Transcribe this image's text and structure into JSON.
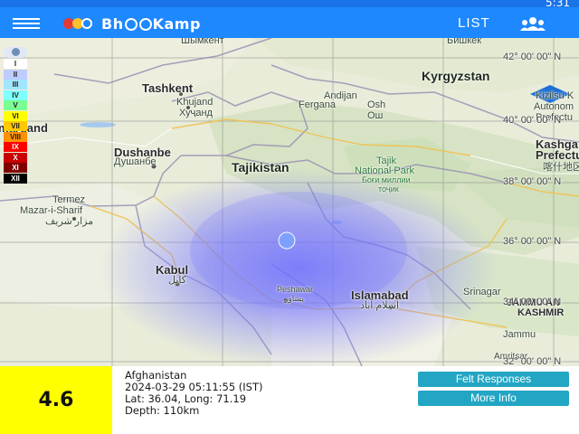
{
  "status_bar": {
    "time": "5:31"
  },
  "app_bar": {
    "title_prefix": "Bh",
    "title_suffix": "Kamp",
    "list_label": "LIST",
    "colors": {
      "bar": "#1e88ff",
      "logo_dot_left": "#e53935",
      "logo_dot_mid": "#fbc02d",
      "logo_dot_right": "#1e88ff"
    }
  },
  "legend": {
    "levels": [
      {
        "label": "I",
        "color": "#ffffff"
      },
      {
        "label": "II",
        "color": "#bfccff"
      },
      {
        "label": "III",
        "color": "#a0e6ff"
      },
      {
        "label": "IV",
        "color": "#80ffff"
      },
      {
        "label": "V",
        "color": "#7aff93"
      },
      {
        "label": "VI",
        "color": "#ffff00"
      },
      {
        "label": "VII",
        "color": "#ffc800"
      },
      {
        "label": "VIII",
        "color": "#ff9100"
      },
      {
        "label": "IX",
        "color": "#ff0000"
      },
      {
        "label": "X",
        "color": "#c80000"
      },
      {
        "label": "XI",
        "color": "#800000"
      },
      {
        "label": "XII",
        "color": "#000000"
      }
    ]
  },
  "map": {
    "places": [
      {
        "id": "shymkent",
        "text": "Шымкент"
      },
      {
        "id": "bishkek",
        "text": "Бишкек"
      },
      {
        "id": "kyrgyzstan",
        "text": "Kyrgyzstan"
      },
      {
        "id": "tashkent",
        "text": "Tashkent"
      },
      {
        "id": "khujand",
        "text": "Khujand"
      },
      {
        "id": "khujand_local",
        "text": "Хуҷанд"
      },
      {
        "id": "andijan",
        "text": "Andijan"
      },
      {
        "id": "fergana",
        "text": "Fergana"
      },
      {
        "id": "osh",
        "text": "Osh"
      },
      {
        "id": "osh_local",
        "text": "Ош"
      },
      {
        "id": "kizilsu",
        "text": "Kizilsu K"
      },
      {
        "id": "autonomous",
        "text": "Autonom"
      },
      {
        "id": "prefecture",
        "text": "Prefectu"
      },
      {
        "id": "samarkand",
        "text": "marqand"
      },
      {
        "id": "dushanbe",
        "text": "Dushanbe"
      },
      {
        "id": "dushanbe_local",
        "text": "Душанбе"
      },
      {
        "id": "tajikistan",
        "text": "Tajikistan"
      },
      {
        "id": "tajik_park",
        "text": "Tajik"
      },
      {
        "id": "tajik_park2",
        "text": "National Park"
      },
      {
        "id": "tajik_park3",
        "text": "Боғи миллии"
      },
      {
        "id": "tajik_park4",
        "text": "тоҷик"
      },
      {
        "id": "kashgar",
        "text": "Kashga"
      },
      {
        "id": "prefecture2",
        "text": "Prefectu"
      },
      {
        "id": "kashgar_local",
        "text": "喀什地区"
      },
      {
        "id": "termez",
        "text": "Termez"
      },
      {
        "id": "mazar",
        "text": "Mazar-i-Sharif"
      },
      {
        "id": "mazar_local",
        "text": "مزار شریف"
      },
      {
        "id": "kabul",
        "text": "Kabul"
      },
      {
        "id": "kabul_local",
        "text": "کابل"
      },
      {
        "id": "peshawar",
        "text": "Peshawar"
      },
      {
        "id": "peshawar_local",
        "text": "پشاور"
      },
      {
        "id": "islamabad",
        "text": "Islamabad"
      },
      {
        "id": "islamabad_local",
        "text": "اسلام آباد"
      },
      {
        "id": "srinagar",
        "text": "Srinagar"
      },
      {
        "id": "jk",
        "text": "JAMMU AN"
      },
      {
        "id": "kashmir",
        "text": "KASHMIR"
      },
      {
        "id": "jammu",
        "text": "Jammu"
      },
      {
        "id": "amritsar",
        "text": "Amritsar"
      }
    ],
    "grid_labels": [
      {
        "id": "lat42",
        "text": "42° 00' 00\" N"
      },
      {
        "id": "lat40",
        "text": "40° 00' 00\" N"
      },
      {
        "id": "lat38",
        "text": "38° 00' 00\" N"
      },
      {
        "id": "lat36",
        "text": "36° 00' 00\" N"
      },
      {
        "id": "lat34",
        "text": "34° 00' 00\" N"
      },
      {
        "id": "lat32",
        "text": "32° 00' 00\" N"
      }
    ]
  },
  "event": {
    "magnitude": "4.6",
    "region": "Afghanistan",
    "datetime": "2024-03-29 05:11:55 (IST)",
    "coordinates": "Lat: 36.04, Long: 71.19",
    "depth": "Depth: 110km",
    "felt_button": "Felt Responses",
    "more_button": "More Info",
    "colors": {
      "magnitude_box": "#ffff00",
      "button": "#22a6c4",
      "shaking": "#6f6fff"
    }
  }
}
